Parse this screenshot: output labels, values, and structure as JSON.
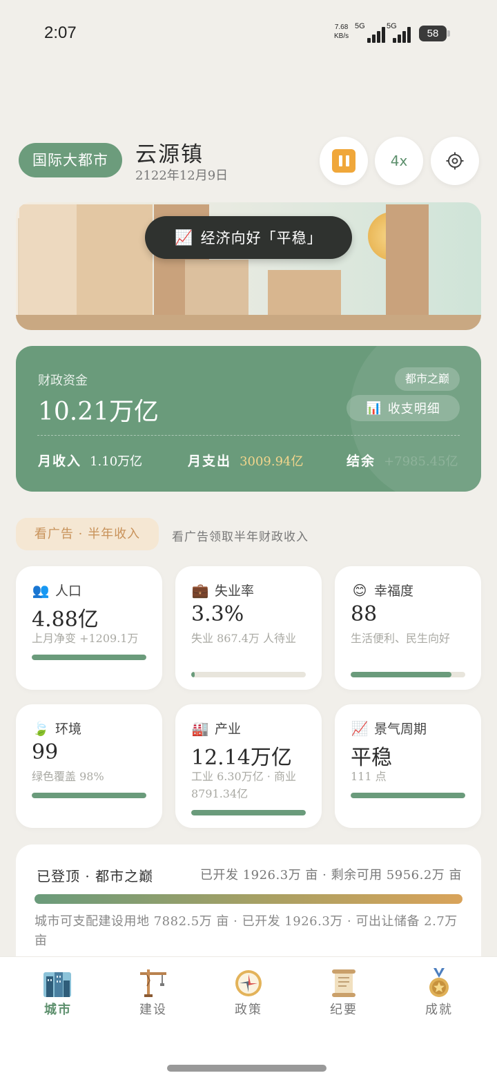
{
  "status_bar": {
    "time": "2:07",
    "net_speed_value": "7.68",
    "net_speed_unit": "KB/s",
    "sim1": "5G",
    "sim2": "5G",
    "battery": "58"
  },
  "header": {
    "tier_label": "国际大都市",
    "city_name": "云源镇",
    "date": "2122年12月9日",
    "pause_icon": "pause-icon",
    "speed_label": "4x",
    "settings_icon": "settings-icon"
  },
  "banner": {
    "trend_icon": "📈",
    "trend_text": "经济向好「平稳」"
  },
  "finance": {
    "label": "财政资金",
    "value": "10.21万亿",
    "tier_badge": "都市之巅",
    "detail_icon": "📊",
    "detail_button": "收支明细",
    "income_label": "月收入",
    "income_value": "1.10万亿",
    "expense_label": "月支出",
    "expense_value": "3009.94亿",
    "balance_label": "结余",
    "balance_value": "+7985.45亿",
    "colors": {
      "card": "#6a9b7b",
      "expense": "#f2d58c",
      "balance": "#8fb39b"
    }
  },
  "ad": {
    "button": "看广告 · 半年收入",
    "description": "看广告领取半年财政收入"
  },
  "stats": [
    {
      "icon": "👥",
      "title": "人口",
      "value": "4.88亿",
      "sub": "上月净变 +1209.1万",
      "progress": 1.0
    },
    {
      "icon": "💼",
      "title": "失业率",
      "value": "3.3%",
      "sub": "失业 867.4万 人待业",
      "progress": 0.03
    },
    {
      "icon": "😊",
      "title": "幸福度",
      "value": "88",
      "sub": "生活便利、民生向好",
      "progress": 0.88
    },
    {
      "icon": "🍃",
      "title": "环境",
      "value": "99",
      "sub": "绿色覆盖 98%",
      "progress": 1.0
    },
    {
      "icon": "🏭",
      "title": "产业",
      "value": "12.14万亿",
      "sub": "工业 6.30万亿 · 商业 8791.34亿",
      "progress": 1.0
    },
    {
      "icon": "📈",
      "title": "景气周期",
      "value": "平稳",
      "sub": "111 点",
      "progress": 1.0
    }
  ],
  "land": {
    "title": "已登顶 · 都市之巅",
    "stats": "已开发 1926.3万 亩 · 剩余可用 5956.2万 亩",
    "desc": "城市可支配建设用地 7882.5万 亩 · 已开发 1926.3万 · 可出让储备 2.7万 亩"
  },
  "nav": [
    {
      "label": "城市",
      "icon": "city-icon",
      "active": true
    },
    {
      "label": "建设",
      "icon": "crane-icon",
      "active": false
    },
    {
      "label": "政策",
      "icon": "compass-icon",
      "active": false
    },
    {
      "label": "纪要",
      "icon": "scroll-icon",
      "active": false
    },
    {
      "label": "成就",
      "icon": "medal-icon",
      "active": false
    }
  ]
}
